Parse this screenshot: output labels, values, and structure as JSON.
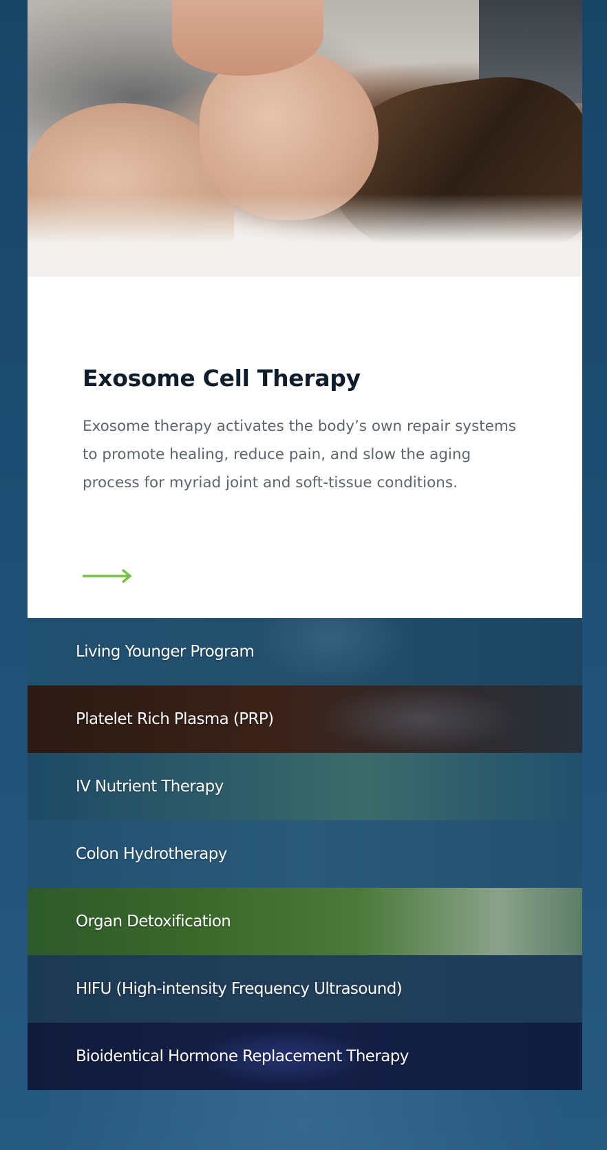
{
  "colors": {
    "page_background": "#1d4a6e",
    "card_background": "#ffffff",
    "title_color": "#0f1d2b",
    "description_color": "#5d646b",
    "arrow_color": "#7ac143",
    "list_text_color": "#ffffff"
  },
  "card": {
    "title": "Exosome Cell Therapy",
    "description": "Exosome therapy activates the body’s own repair systems to promote healing, reduce pain, and slow the aging process for myriad joint and soft-tissue conditions.",
    "arrow_icon": "right-arrow-icon"
  },
  "services": [
    {
      "label": "Living Younger Program"
    },
    {
      "label": "Platelet Rich Plasma (PRP)"
    },
    {
      "label": "IV Nutrient Therapy"
    },
    {
      "label": "Colon Hydrotherapy"
    },
    {
      "label": "Organ Detoxification"
    },
    {
      "label": "HIFU (High-intensity Frequency Ultrasound)"
    },
    {
      "label": "Bioidentical Hormone Replacement Therapy"
    }
  ]
}
